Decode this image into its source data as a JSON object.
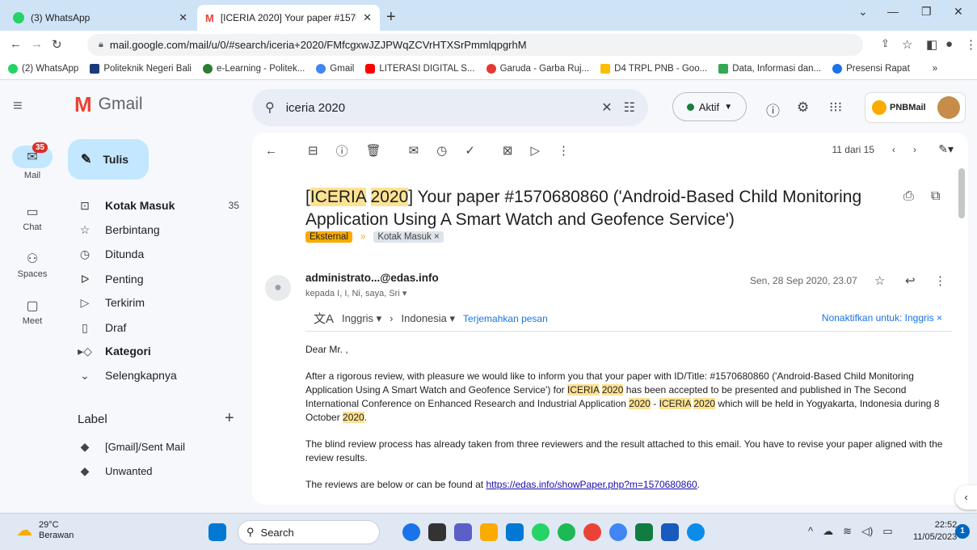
{
  "browser": {
    "tabs": [
      {
        "label": "(3) WhatsApp",
        "icon": "whatsapp-icon"
      },
      {
        "label": "[ICERIA 2020] Your paper #1570",
        "icon": "gmail-icon"
      }
    ],
    "new_tab": "+",
    "url": "mail.google.com/mail/u/0/#search/iceria+2020/FMfcgxwJZJPWqZCVrHTXSrPmmlqpgrhM",
    "bookmarks": [
      {
        "label": "(2) WhatsApp",
        "color": "#25d366"
      },
      {
        "label": "Politeknik Negeri Bali",
        "color": "#1a3a7a"
      },
      {
        "label": "e-Learning - Politek...",
        "color": "#2e7d32"
      },
      {
        "label": "Gmail",
        "color": "#4285f4"
      },
      {
        "label": "LITERASI DIGITAL S...",
        "color": "#ff0000"
      },
      {
        "label": "Garuda - Garba Ruj...",
        "color": "#e53935"
      },
      {
        "label": "D4 TRPL PNB - Goo...",
        "color": "#fbbc04"
      },
      {
        "label": "Data, Informasi dan...",
        "color": "#34a853"
      },
      {
        "label": "Presensi Rapat",
        "color": "#1a73e8"
      }
    ],
    "bookmarks_more": "»"
  },
  "gmail": {
    "logo": "Gmail",
    "search_value": "iceria 2020",
    "status": "Aktif",
    "account_label": "PNBMail",
    "rail": {
      "mail": "Mail",
      "mail_badge": "35",
      "chat": "Chat",
      "spaces": "Spaces",
      "meet": "Meet"
    },
    "compose": "Tulis",
    "folders": [
      {
        "label": "Kotak Masuk",
        "count": "35",
        "icon": "inbox-icon"
      },
      {
        "label": "Berbintang",
        "count": "",
        "icon": "star-icon"
      },
      {
        "label": "Ditunda",
        "count": "",
        "icon": "clock-icon"
      },
      {
        "label": "Penting",
        "count": "",
        "icon": "important-icon"
      },
      {
        "label": "Terkirim",
        "count": "",
        "icon": "send-icon"
      },
      {
        "label": "Draf",
        "count": "",
        "icon": "draft-icon"
      },
      {
        "label": "Kategori",
        "count": "",
        "icon": "label-icon"
      },
      {
        "label": "Selengkapnya",
        "count": "",
        "icon": "chevron-down-icon"
      }
    ],
    "label_heading": "Label",
    "user_labels": [
      "[Gmail]/Sent Mail",
      "Unwanted"
    ],
    "pager": "11 dari 15",
    "email": {
      "subject_pre": "[",
      "subject_hl1": "ICERIA",
      "subject_sp": " ",
      "subject_hl2": "2020",
      "subject_post": "] Your paper #1570680860 ('Android-Based Child Monitoring Application Using A Smart Watch and Geofence Service')",
      "label_external": "Eksternal",
      "label_inbox": "Kotak Masuk ×",
      "sender": "administrato...@edas.info",
      "recipients": "kepada I, I, Ni, saya, Sri ▾",
      "date": "Sen, 28 Sep 2020, 23.07",
      "translate_from": "Inggris ▾",
      "translate_to": "Indonesia ▾",
      "translate_link": "Terjemahkan pesan",
      "translate_off": "Nonaktifkan untuk: Inggris ×",
      "greeting": "Dear Mr. ,",
      "p1_a": "After a rigorous review, with pleasure we would like to inform you that your paper with ID/Title: #1570680860 ('Android-Based Child Monitoring Application Using A Smart Watch and Geofence Service') for ",
      "p1_hl1": "ICERIA",
      "p1_hl2": "2020",
      "p1_b": " has been accepted to be presented and published in The Second International Conference on Enhanced Research and Industrial Application ",
      "p1_hl3": "2020",
      "p1_dash": " - ",
      "p1_hl4": "ICERIA",
      "p1_hl5": "2020",
      "p1_c": " which will be held in Yogyakarta, Indonesia during 8 October ",
      "p1_hl6": "2020",
      "p1_end": ".",
      "p2": "The blind review process has already taken from three reviewers and the result attached to this email. You have to revise your paper aligned with the review results.",
      "p3_a": "The reviews are below or can be found at ",
      "p3_link": "https://edas.info/showPaper.php?m=1570680860",
      "p3_end": "."
    }
  },
  "taskbar": {
    "temp": "29°C",
    "weather": "Berawan",
    "search": "Search",
    "time": "22:52",
    "date": "11/05/2023",
    "notif_count": "1"
  },
  "colors": {
    "highlight": "#fde293",
    "accent": "#c2e7ff",
    "badge": "#d93025"
  }
}
